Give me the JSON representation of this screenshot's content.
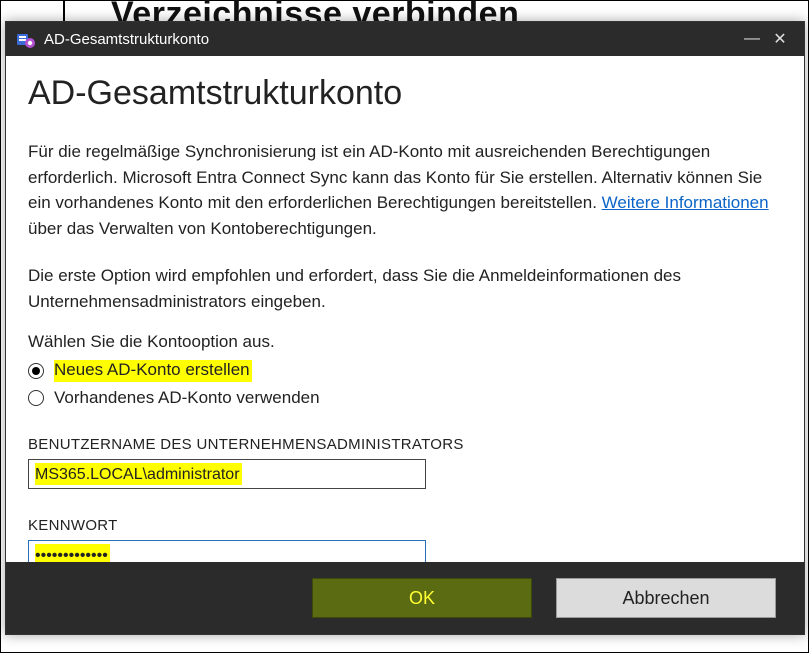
{
  "window": {
    "bg_partial_text": "Verzeichnisse verbinden",
    "title": "AD-Gesamtstrukturkonto",
    "minimize": "—",
    "close": "✕"
  },
  "main": {
    "heading": "AD-Gesamtstrukturkonto",
    "para1a": "Für die regelmäßige Synchronisierung ist ein AD-Konto mit ausreichenden Berechtigungen erforderlich. Microsoft Entra Connect Sync kann das Konto für Sie erstellen. Alternativ können Sie ein vorhandenes Konto mit den erforderlichen Berechtigungen bereitstellen. ",
    "link_text": "Weitere Informationen",
    "para1b": " über das Verwalten von Kontoberechtigungen.",
    "para2": "Die erste Option wird empfohlen und erfordert, dass Sie die Anmeldeinformationen des Unternehmensadministrators eingeben.",
    "option_prompt": "Wählen Sie die Kontooption aus.",
    "radio1": "Neues AD-Konto erstellen",
    "radio2": "Vorhandenes AD-Konto verwenden",
    "username_label": "BENUTZERNAME DES UNTERNEHMENSADMINISTRATORS",
    "username_value": "MS365.LOCAL\\administrator",
    "password_label": "KENNWORT",
    "password_mask": "•••••••••••••"
  },
  "footer": {
    "ok": "OK",
    "cancel": "Abbrechen"
  }
}
